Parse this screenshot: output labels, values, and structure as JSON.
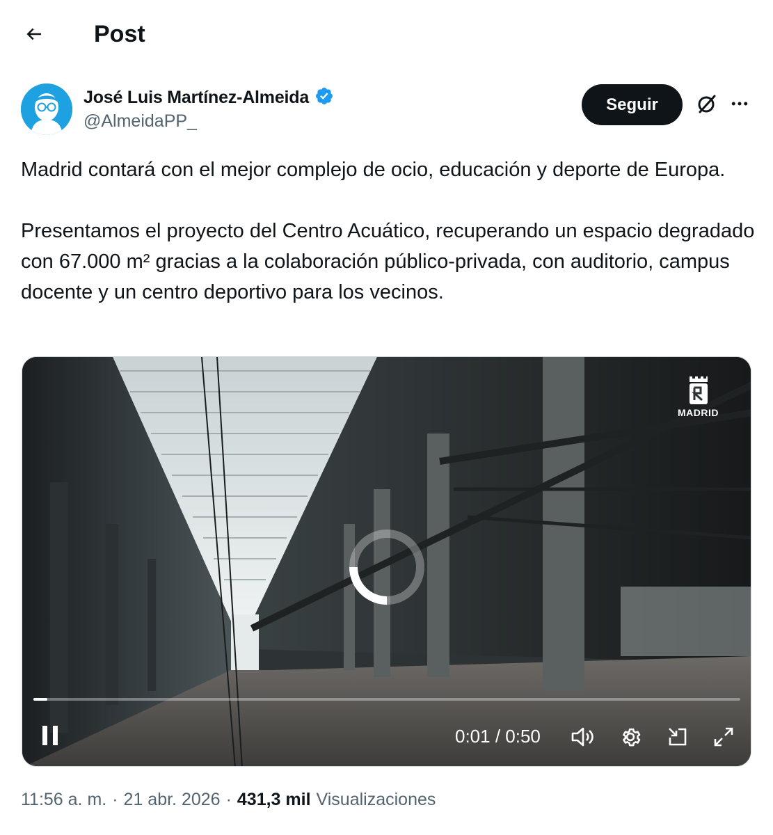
{
  "header": {
    "title": "Post"
  },
  "post": {
    "author": {
      "name": "José Luis Martínez-Almeida",
      "handle": "@AlmeidaPP_",
      "verified": true,
      "avatar_color": "#1da1e0"
    },
    "follow_label": "Seguir",
    "text_paragraphs": [
      "Madrid contará con el mejor complejo de ocio, educación y deporte de Europa.",
      "Presentamos el proyecto del Centro Acuático, recuperando un espacio degradado con 67.000 m² gracias a la colaboración público-privada, con auditorio, campus docente y un centro deportivo para los vecinos."
    ],
    "media": {
      "watermark": "MADRID",
      "time_display": "0:01 / 0:50",
      "progress_fraction": 0.02,
      "state": "playing-loading"
    },
    "meta": {
      "time": "11:56 a. m.",
      "date": "21 abr. 2026",
      "separator": "·",
      "views_count": "431,3 mil",
      "views_label": "Visualizaciones"
    }
  },
  "colors": {
    "text_primary": "#0f1419",
    "text_secondary": "#536471",
    "verified_badge": "#1d9bf0",
    "follow_button_bg": "#0f1419"
  }
}
